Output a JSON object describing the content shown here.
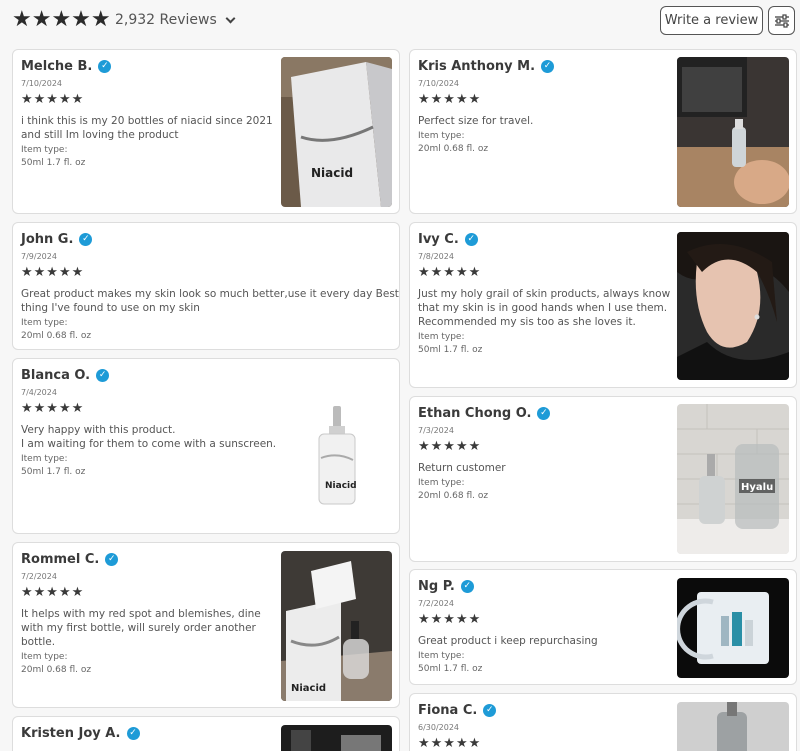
{
  "header": {
    "review_count": "2,932 Reviews",
    "write_review": "Write a review",
    "rating_stars": "★★★★★"
  },
  "item_type_label": "Item type:",
  "reviews": [
    {
      "name": "Melche B.",
      "date": "7/10/2024",
      "stars": "★★★★★",
      "lines": [
        "i think this is my 20 bottles of niacid since 2021",
        "and still Im loving the product"
      ],
      "item_type": "50ml 1.7 fl. oz"
    },
    {
      "name": "Kris Anthony M.",
      "date": "7/10/2024",
      "stars": "★★★★★",
      "lines": [
        "Perfect size for travel."
      ],
      "item_type": "20ml 0.68 fl. oz"
    },
    {
      "name": "John G.",
      "date": "7/9/2024",
      "stars": "★★★★★",
      "lines": [
        "Great product makes my skin look so much better,use it every day Best",
        "thing I've found to use on my skin"
      ],
      "item_type": "20ml 0.68 fl. oz"
    },
    {
      "name": "Ivy C.",
      "date": "7/8/2024",
      "stars": "★★★★★",
      "lines": [
        "Just my holy grail of skin products, always know",
        "that my skin is in good hands when I use them.",
        "Recommended my sis too as she loves it."
      ],
      "item_type": "50ml 1.7 fl. oz"
    },
    {
      "name": "Blanca O.",
      "date": "7/4/2024",
      "stars": "★★★★★",
      "lines": [
        "Very happy with this product.",
        "I am waiting for them to come with a sunscreen."
      ],
      "item_type": "50ml 1.7 fl. oz"
    },
    {
      "name": "Ethan Chong O.",
      "date": "7/3/2024",
      "stars": "★★★★★",
      "lines": [
        "Return customer"
      ],
      "item_type": "20ml 0.68 fl. oz"
    },
    {
      "name": "Rommel C.",
      "date": "7/2/2024",
      "stars": "★★★★★",
      "lines": [
        "It helps with my red spot and blemishes, dine",
        "with my first bottle, will surely order another",
        "bottle."
      ],
      "item_type": "20ml 0.68 fl. oz"
    },
    {
      "name": "Ng P.",
      "date": "7/2/2024",
      "stars": "★★★★★",
      "lines": [
        "Great product i keep repurchasing"
      ],
      "item_type": "50ml 1.7 fl. oz"
    },
    {
      "name": "Kristen Joy A.",
      "date": "",
      "stars": "",
      "lines": [],
      "item_type": ""
    },
    {
      "name": "Fiona C.",
      "date": "6/30/2024",
      "stars": "★★★★★",
      "lines": [],
      "item_type": ""
    }
  ],
  "photo_labels": {
    "box": "Niacid",
    "bottle": "Niacid",
    "bottle_small": "Niacid",
    "duo": "Hyalu"
  }
}
